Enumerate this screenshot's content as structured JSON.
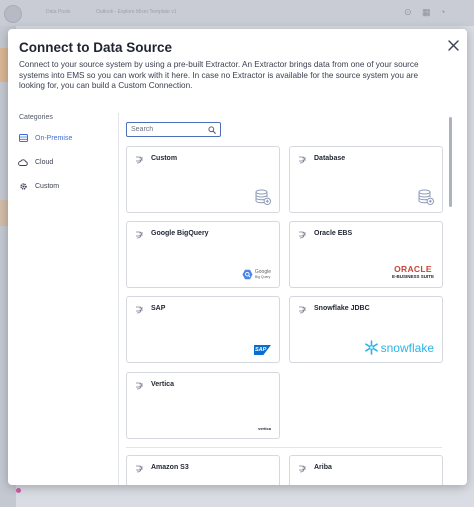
{
  "background": {
    "breadcrumb": [
      "Data Pools",
      "Outlook - Explore Mixer Template v1"
    ]
  },
  "modal": {
    "title": "Connect to Data Source",
    "description": "Connect to your source system by using a pre-built Extractor. An Extractor brings data from one of your source systems into EMS so you can work with it here. In case no Extractor is available for the source system you are looking for, you can build a Custom Connection."
  },
  "categories": {
    "heading": "Categories",
    "items": [
      {
        "label": "On-Premise",
        "icon": "server-icon",
        "active": true
      },
      {
        "label": "Cloud",
        "icon": "cloud-icon",
        "active": false
      },
      {
        "label": "Custom",
        "icon": "gear-icon",
        "active": false
      }
    ]
  },
  "search": {
    "placeholder": "Search"
  },
  "connectors": [
    {
      "name": "Custom",
      "logo": "database-plus-icon"
    },
    {
      "name": "Database",
      "logo": "database-plus-icon"
    },
    {
      "name": "Google BigQuery",
      "logo": "google-bigquery-logo",
      "logo_text": "Google",
      "logo_subtext": "Big Query"
    },
    {
      "name": "Oracle EBS",
      "logo": "oracle-logo",
      "logo_text": "ORACLE",
      "logo_subtext": "E-BUSINESS SUITE"
    },
    {
      "name": "SAP",
      "logo": "sap-logo",
      "logo_text": "SAP"
    },
    {
      "name": "Snowflake JDBC",
      "logo": "snowflake-logo",
      "logo_text": "snowflake"
    },
    {
      "name": "Vertica",
      "logo": "vertica-logo",
      "logo_text": "vertica"
    },
    {
      "name": "Amazon S3",
      "logo": ""
    },
    {
      "name": "Ariba",
      "logo": ""
    }
  ],
  "colors": {
    "accent": "#3f6fd6",
    "oracle_red": "#c74634",
    "sap_blue": "#0a6ed1",
    "snowflake_blue": "#29b5e8",
    "db_icon": "#8d9ab8"
  }
}
